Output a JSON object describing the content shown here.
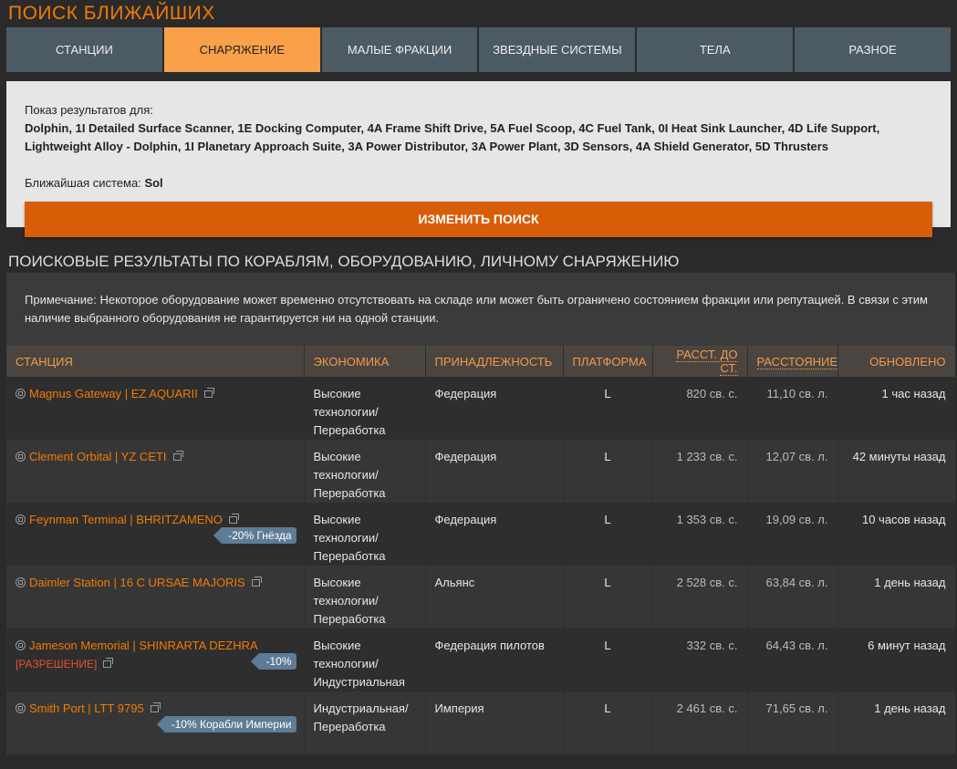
{
  "title": "ПОИСК БЛИЖАЙШИХ",
  "tabs": [
    {
      "label": "СТАНЦИИ"
    },
    {
      "label": "СНАРЯЖЕНИЕ"
    },
    {
      "label": "МАЛЫЕ ФРАКЦИИ"
    },
    {
      "label": "ЗВЕЗДНЫЕ СИСТЕМЫ"
    },
    {
      "label": "ТЕЛА"
    },
    {
      "label": "РАЗНОЕ"
    }
  ],
  "search": {
    "label": "Показ результатов для:",
    "items": "Dolphin, 1I Detailed Surface Scanner, 1E Docking Computer, 4A Frame Shift Drive, 5A Fuel Scoop, 4C Fuel Tank, 0I Heat Sink Launcher, 4D Life Support, Lightweight Alloy - Dolphin, 1I Planetary Approach Suite, 3A Power Distributor, 3A Power Plant, 3D Sensors, 4A Shield Generator, 5D Thrusters",
    "nearest_label": "Ближайшая система:",
    "nearest_value": "Sol",
    "button": "ИЗМЕНИТЬ ПОИСК"
  },
  "results": {
    "title": "ПОИСКОВЫЕ РЕЗУЛЬТАТЫ ПО КОРАБЛЯМ, ОБОРУДОВАНИЮ, ЛИЧНОМУ СНАРЯЖЕНИЮ",
    "note": "Примечание: Некоторое оборудование может временно отсутствовать на складе или может быть ограничено состоянием фракции или репутацией. В связи с этим наличие выбранного оборудования не гарантируется ни на одной станции.",
    "columns": {
      "station": "СТАНЦИЯ",
      "economy": "ЭКОНОМИКА",
      "allegiance": "ПРИНАДЛЕЖНОСТЬ",
      "platform": "ПЛАТФОРМА",
      "arrival": "РАССТ. ДО СТ.",
      "distance": "РАССТОЯНИЕ",
      "updated": "ОБНОВЛЕНО"
    },
    "rows": [
      {
        "station": "Magnus Gateway | EZ AQUARII",
        "permit": "",
        "badge": "",
        "economy": [
          "Высокие",
          "технологии/",
          "Переработка"
        ],
        "allegiance": "Федерация",
        "platform": "L",
        "arrival": "820 св. с.",
        "distance": "11,10 св. л.",
        "updated": "1 час назад",
        "icon": "station-icon"
      },
      {
        "station": "Clement Orbital | YZ CETI",
        "permit": "",
        "badge": "",
        "economy": [
          "Высокие",
          "технологии/",
          "Переработка"
        ],
        "allegiance": "Федерация",
        "platform": "L",
        "arrival": "1 233 св. с.",
        "distance": "12,07 св. л.",
        "updated": "42 минуты назад",
        "icon": "station-icon"
      },
      {
        "station": "Feynman Terminal | BHRITZAMENO",
        "permit": "",
        "badge": "-20% Гнёзда",
        "economy": [
          "Высокие",
          "технологии/",
          "Переработка"
        ],
        "allegiance": "Федерация",
        "platform": "L",
        "arrival": "1 353 св. с.",
        "distance": "19,09 св. л.",
        "updated": "10 часов назад",
        "icon": "station-icon"
      },
      {
        "station": "Daimler Station | 16 C URSAE MAJORIS",
        "permit": "",
        "badge": "",
        "economy": [
          "Высокие",
          "технологии/",
          "Переработка"
        ],
        "allegiance": "Альянс",
        "platform": "L",
        "arrival": "2 528 св. с.",
        "distance": "63,84 св. л.",
        "updated": "1 день назад",
        "icon": "station-icon"
      },
      {
        "station": "Jameson Memorial | SHINRARTA DEZHRA",
        "permit": "[РАЗРЕШЕНИЕ]",
        "badge": "-10%",
        "economy": [
          "Высокие",
          "технологии/",
          "Индустриальная"
        ],
        "allegiance": "Федерация пилотов",
        "platform": "L",
        "arrival": "332 св. с.",
        "distance": "64,43 св. л.",
        "updated": "6 минут назад",
        "icon": "pilots-icon"
      },
      {
        "station": "Smith Port | LTT 9795",
        "permit": "",
        "badge": "-10% Корабли Империи",
        "economy": [
          "Индустриальная/",
          "Переработка"
        ],
        "allegiance": "Империя",
        "platform": "L",
        "arrival": "2 461 св. с.",
        "distance": "71,65 св. л.",
        "updated": "1 день назад",
        "icon": "orbis-icon"
      }
    ]
  },
  "colors": {
    "accent": "#f07b05",
    "button": "#d85d07",
    "active_tab": "#f9a14a",
    "badge": "#5d7c96"
  }
}
